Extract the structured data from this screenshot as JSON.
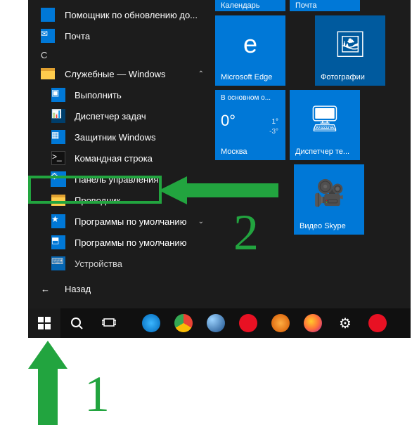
{
  "left": {
    "update_assistant": "Помощник по обновлению до...",
    "mail": "Почта",
    "letter": "С",
    "system_folder": "Служебные — Windows",
    "items": {
      "run": "Выполнить",
      "taskmgr": "Диспетчер задач",
      "defender": "Защитник Windows",
      "cmd": "Командная строка",
      "control": "Панель управления",
      "explorer": "Проводник",
      "defaults1": "Программы по умолчанию",
      "defaults2": "Программы по умолчанию",
      "devices": "Устройства"
    },
    "back": "Назад"
  },
  "tiles": {
    "calendar": "Календарь",
    "mail": "Почта",
    "edge": "Microsoft Edge",
    "photos": "Фотографии",
    "weather": {
      "header": "В основном о...",
      "temp": "0°",
      "hi": "1°",
      "lo": "-3°",
      "city": "Москва"
    },
    "remote": "Диспетчер те...",
    "skype": "Видео Skype"
  },
  "annotations": {
    "num1": "1",
    "num2": "2"
  }
}
